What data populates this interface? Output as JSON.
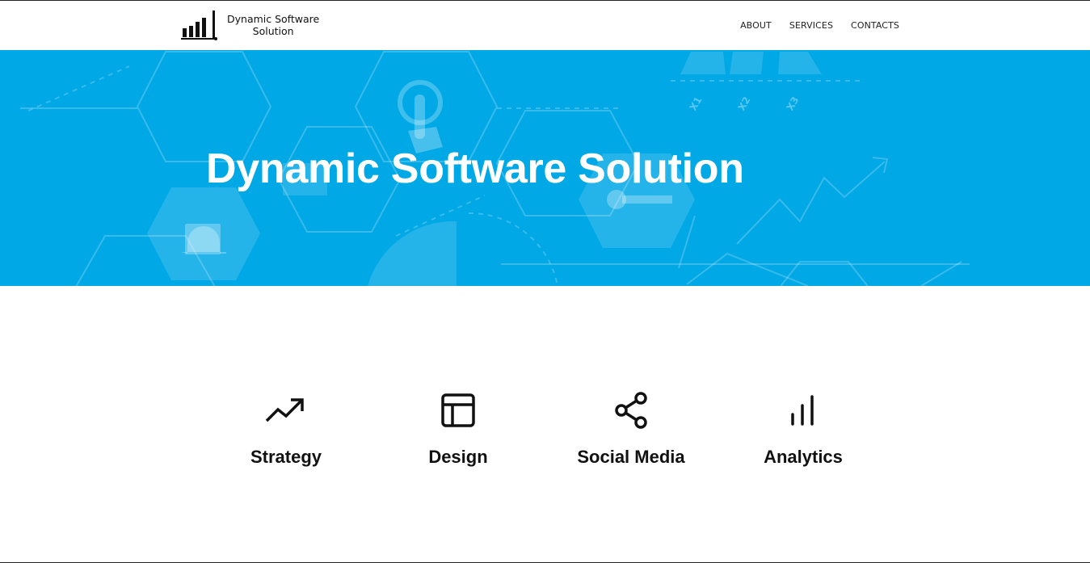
{
  "header": {
    "logo": {
      "line1": "Dynamic Software",
      "line2": "Solution",
      "icon": "bar-chart-logo-icon"
    },
    "nav": [
      {
        "label": "ABOUT"
      },
      {
        "label": "SERVICES"
      },
      {
        "label": "CONTACTS"
      }
    ]
  },
  "hero": {
    "title": "Dynamic Software Solution",
    "background_color": "#00a8e6"
  },
  "services": [
    {
      "label": "Strategy",
      "icon": "trending-up-icon"
    },
    {
      "label": "Design",
      "icon": "layout-icon"
    },
    {
      "label": "Social Media",
      "icon": "share-icon"
    },
    {
      "label": "Analytics",
      "icon": "bar-chart-icon"
    }
  ]
}
